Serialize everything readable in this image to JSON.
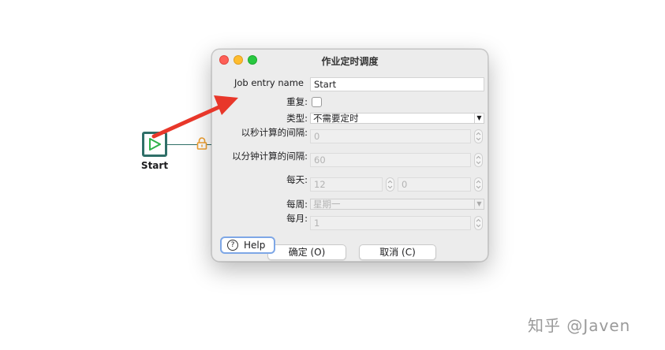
{
  "canvas": {
    "start_label": "Start"
  },
  "dialog": {
    "title": "作业定时调度",
    "fields": {
      "job_entry_name_label": "Job entry name",
      "job_entry_name_value": "Start",
      "repeat_label": "重复:",
      "repeat_checked": false,
      "type_label": "类型:",
      "type_value": "不需要定时",
      "interval_seconds_label": "以秒计算的间隔:",
      "interval_seconds_value": "0",
      "interval_minutes_label": "以分钟计算的间隔:",
      "interval_minutes_value": "60",
      "daily_label": "每天:",
      "daily_hour_value": "12",
      "daily_minute_value": "0",
      "weekly_label": "每周:",
      "weekly_value": "星期一",
      "monthly_label": "每月:",
      "monthly_value": "1"
    },
    "buttons": {
      "help": "Help",
      "ok": "确定 (O)",
      "cancel": "取消 (C)"
    }
  },
  "watermark": "知乎 @Javen",
  "colors": {
    "arrow": "#e8372a",
    "node_border": "#2f6f68",
    "lock": "#f0a030",
    "help_focus": "#7ea7e6"
  }
}
